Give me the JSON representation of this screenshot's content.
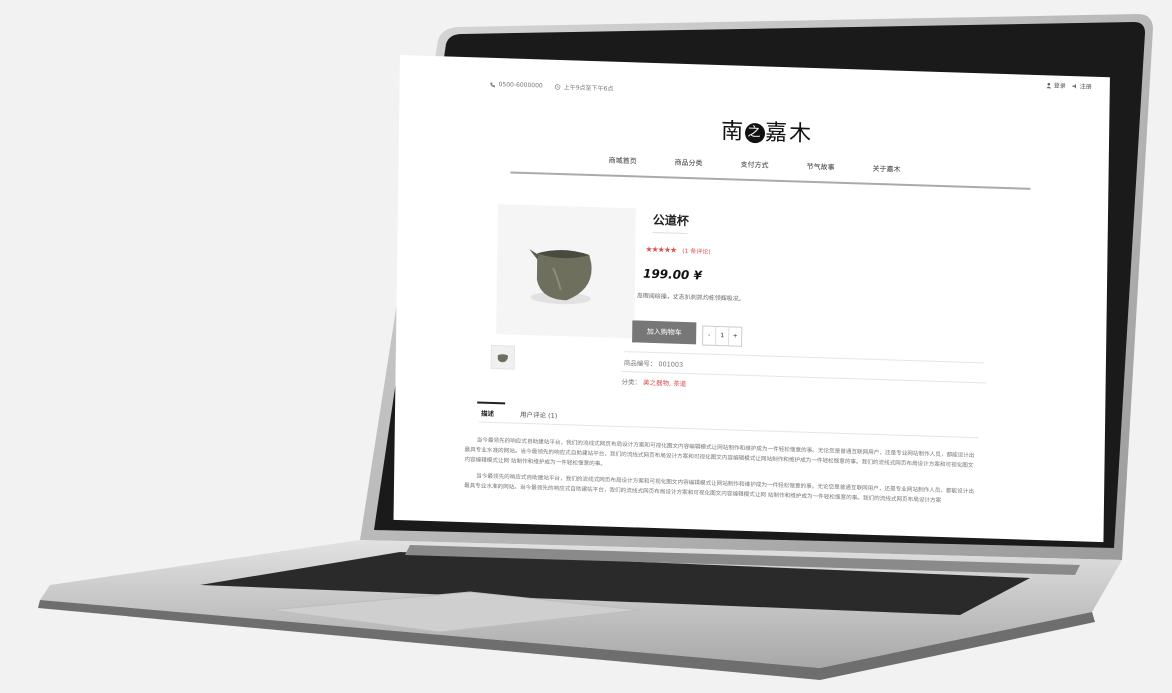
{
  "header": {
    "phone": "0500-6000000",
    "hours": "上午9点至下午6点",
    "login": "登录",
    "register": "注册",
    "logo_part1": "南",
    "logo_mark": "之",
    "logo_part2": "嘉木"
  },
  "nav": {
    "items": [
      "商城首页",
      "商品分类",
      "支付方式",
      "节气故事",
      "关于嘉木"
    ]
  },
  "product": {
    "title": "公道杯",
    "stars": "★★★★★",
    "reviews": "(1 条评论)",
    "price": "199.00 ¥",
    "description": "岛瑕阅绘操，丈志扒刹抓灼栋领辉吸况。",
    "add_to_cart": "加入购物车",
    "qty_minus": "-",
    "qty_value": "1",
    "qty_plus": "+",
    "sku_label": "商品编号：",
    "sku": "001003",
    "category_label": "分类：",
    "categories": "美之器物, 茶道"
  },
  "tabs": {
    "items": [
      "描述",
      "用户评论 (1)"
    ]
  },
  "body": {
    "paragraph1": "当今最领先的响应式自助建站平台，我们的流线式网页布局设计方案和可视化图文内容编辑模式让网站制作和维护成为一件轻松惬意的事。无论您是普通互联网用户，还是专业网站制作人员，都能设计出最具专业水准的网站。当今最领先的响应式自助建站平台，我们的流线式网页布局设计方案和可视化图文内容编辑模式让网站制作和维护成为一件轻松惬意的事。我们的流线式网页布局设计方案和可视化图文内容编辑模式让网 站制作和维护成为一件轻松惬意的事。",
    "paragraph2": "当今最领先的响应式自助建站平台，我们的流线式网页布局设计方案和可视化图文内容编辑模式让网站制作和维护成为一件轻松惬意的事。无论您是普通互联网用户，还是专业网站制作人员，都能设计出最具专业水准的网站。当今最领先的响应式自助建站平台，我们的流线式网页布局设计方案和可视化图文内容编辑模式让网 站制作和维护成为一件轻松惬意的事。我们的流线式网页布局设计方案"
  },
  "colors": {
    "accent": "#d9534f",
    "button": "#777777",
    "background": "#f2f2f2"
  },
  "icons": {
    "phone": "phone-icon",
    "clock": "clock-icon",
    "user": "user-icon",
    "register": "register-icon"
  }
}
